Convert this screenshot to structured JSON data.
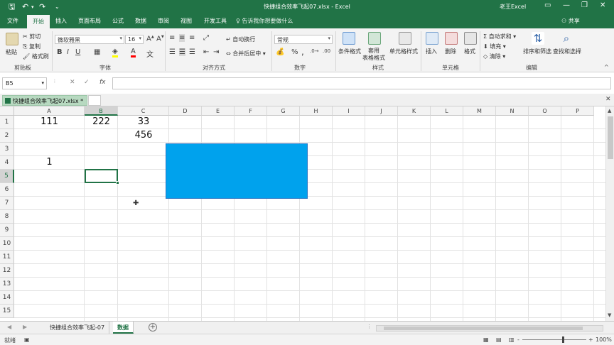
{
  "titlebar": {
    "title": "快捷组合效率飞起07.xlsx - Excel",
    "user": "老王Excel",
    "save_icon": "save-icon",
    "undo_icon": "undo-icon",
    "redo_icon": "redo-icon",
    "minimize": "—",
    "restore": "❐",
    "close": "✕",
    "ribbon_display": "▭"
  },
  "menu": {
    "tabs": [
      "文件",
      "开始",
      "插入",
      "页面布局",
      "公式",
      "数据",
      "审阅",
      "视图",
      "开发工具"
    ],
    "active_tab": "开始",
    "tell_me": "告诉我你想要做什么",
    "share": "共享"
  },
  "ribbon": {
    "clipboard": {
      "label": "剪贴板",
      "paste": "粘贴",
      "cut": "剪切",
      "copy": "复制",
      "format_painter": "格式刷"
    },
    "font": {
      "label": "字体",
      "font_name": "微软雅黑",
      "font_size": "16",
      "bold": "B",
      "italic": "I",
      "underline": "U",
      "font_color_glyph": "A",
      "fill_glyph": "A"
    },
    "alignment": {
      "label": "对齐方式",
      "wrap_text": "自动换行",
      "merge_center": "合并后居中"
    },
    "number": {
      "label": "数字",
      "format": "常规",
      "percent": "%",
      "comma": ","
    },
    "styles": {
      "label": "样式",
      "conditional": "条件格式",
      "as_table": "套用\n表格格式",
      "cell_styles": "单元格样式"
    },
    "cells": {
      "label": "单元格",
      "insert": "插入",
      "delete": "删除",
      "format": "格式"
    },
    "editing": {
      "label": "编辑",
      "autosum": "自动求和",
      "fill": "填充",
      "clear": "清除",
      "sort_filter": "排序和筛选",
      "find_select": "查找和选择"
    }
  },
  "formula_bar": {
    "name_box": "B5",
    "cancel": "✕",
    "enter": "✓",
    "fx": "fx",
    "value": ""
  },
  "workbook_tab": {
    "name": "快捷组合效率飞起07.xlsx *"
  },
  "grid": {
    "columns": [
      "A",
      "B",
      "C",
      "D",
      "E",
      "F",
      "G",
      "H",
      "I",
      "J",
      "K",
      "L",
      "M",
      "N",
      "O",
      "P"
    ],
    "rows": [
      "1",
      "2",
      "3",
      "4",
      "5",
      "6",
      "7",
      "8",
      "9",
      "10",
      "11",
      "12",
      "13",
      "14",
      "15"
    ],
    "selected_column": "B",
    "selected_row": "5",
    "cells": {
      "A1": "111",
      "B1": "222",
      "C1": "33",
      "C2": "456",
      "A4": "1"
    },
    "shape_color": "#00A2ED"
  },
  "sheets": {
    "tabs": [
      "快捷组合效率飞起-07",
      "数据"
    ],
    "active": "数据",
    "add": "+"
  },
  "status": {
    "mode": "就绪",
    "zoom": "100%",
    "zoom_minus": "-",
    "zoom_plus": "+"
  },
  "colors": {
    "accent": "#217346",
    "ribbon_bg": "#F3F3F3",
    "shape": "#00A2ED"
  }
}
